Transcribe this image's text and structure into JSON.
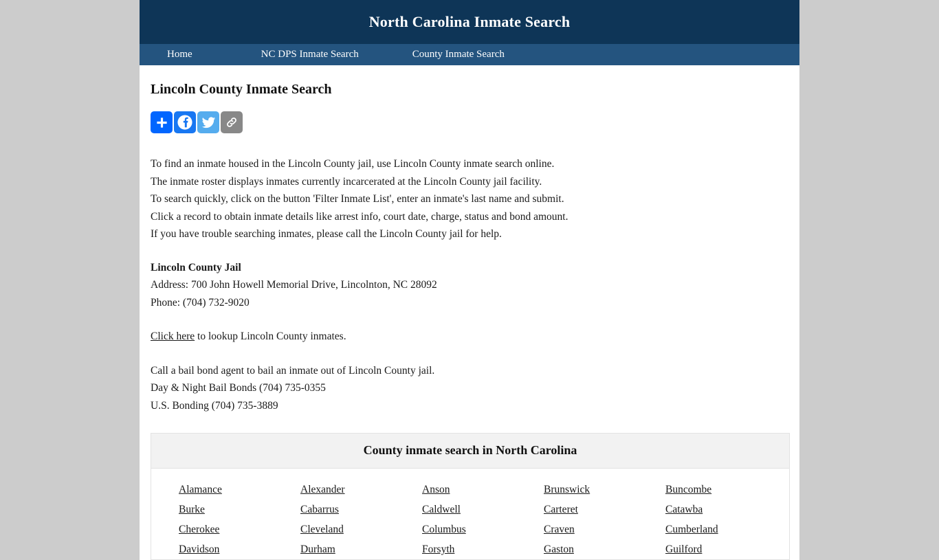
{
  "site": {
    "title": "North Carolina Inmate Search"
  },
  "nav": {
    "items": [
      {
        "label": "Home",
        "name": "nav-home"
      },
      {
        "label": "NC DPS Inmate Search",
        "name": "nav-ncdps-inmate-search"
      },
      {
        "label": "County Inmate Search",
        "name": "nav-county-inmate-search"
      }
    ]
  },
  "main": {
    "heading": "Lincoln County Inmate Search",
    "share": {
      "buttons": [
        {
          "icon": "addtoany-plus-icon",
          "label": "Share",
          "color": "#0166ff"
        },
        {
          "icon": "facebook-icon",
          "label": "Facebook",
          "color": "#1877f2"
        },
        {
          "icon": "twitter-icon",
          "label": "Twitter",
          "color": "#55acee"
        },
        {
          "icon": "link-icon",
          "label": "Copy Link",
          "color": "#888888"
        }
      ]
    },
    "intro_lines": [
      "To find an inmate housed in the Lincoln County jail, use Lincoln County inmate search online.",
      "The inmate roster displays inmates currently incarcerated at the Lincoln County jail facility.",
      "To search quickly, click on the button 'Filter Inmate List', enter an inmate's last name and submit.",
      "Click a record to obtain inmate details like arrest info, court date, charge, status and bond amount.",
      "If you have trouble searching inmates, please call the Lincoln County jail for help."
    ],
    "jail": {
      "name": "Lincoln County Jail",
      "address": "Address: 700 John Howell Memorial Drive, Lincolnton, NC 28092",
      "phone": "Phone: (704) 732-9020"
    },
    "lookup": {
      "link_text": "Click here",
      "rest_text": " to lookup Lincoln County inmates."
    },
    "bail": {
      "intro": "Call a bail bond agent to bail an inmate out of Lincoln County jail.",
      "agents": [
        "Day & Night Bail Bonds (704) 735-0355",
        "U.S. Bonding (704) 735-3889"
      ]
    }
  },
  "county_table": {
    "caption": "County inmate search in North Carolina",
    "rows": [
      [
        "Alamance",
        "Alexander",
        "Anson",
        "Brunswick",
        "Buncombe"
      ],
      [
        "Burke",
        "Cabarrus",
        "Caldwell",
        "Carteret",
        "Catawba"
      ],
      [
        "Cherokee",
        "Cleveland",
        "Columbus",
        "Craven",
        "Cumberland"
      ],
      [
        "Davidson",
        "Durham",
        "Forsyth",
        "Gaston",
        "Guilford"
      ]
    ]
  },
  "theme": {
    "header_bg": "#0e3557",
    "nav_bg": "#24547f",
    "page_bg": "#cccccc",
    "content_bg": "#ffffff",
    "caption_bg": "#f2f2f2",
    "text": "#1a1a1a"
  }
}
